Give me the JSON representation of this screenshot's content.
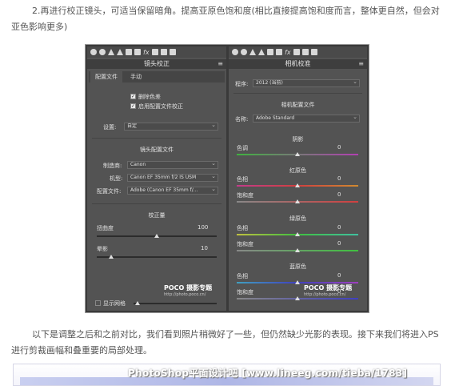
{
  "article": {
    "para1": "2.再进行校正镜头，可适当保留暗角。提高亚原色饱和度(相比直接提高饱和度而言，整体更自然，但会对亚色影响更多)",
    "para2": "以下是调整之后和之前对比，我们看到照片稍微好了一些，但仍然缺少光影的表现。接下来我们将进入PS进行剪裁画幅和叠重要的局部处理。",
    "overlay": "PhotoShop平面设计吧 [www.lineeg.com/tieba/1783]"
  },
  "left": {
    "title": "镜头校正",
    "menu": "≡",
    "tabs": [
      "配置文件",
      "手动"
    ],
    "checkbox1": "删除色差",
    "checkbox2": "启用配置文件校正",
    "setup_label": "设置:",
    "setup_value": "自定",
    "section_profile": "镜头配置文件",
    "make_label": "制造商:",
    "make_value": "Canon",
    "model_label": "机型:",
    "model_value": "Canon EF 35mm f/2 IS USM",
    "profile_label": "配置文件:",
    "profile_value": "Adobe (Canon EF 35mm f/...",
    "section_amount": "校正量",
    "distortion_label": "扭曲度",
    "distortion_value": "100",
    "vignette_label": "晕影",
    "vignette_value": "10",
    "grid_label": "显示网格",
    "watermark": "POCO 摄影专题",
    "watermark_url": "http://photo.poco.cn/"
  },
  "right": {
    "title": "相机校准",
    "menu": "≡",
    "process_label": "程序:",
    "process_value": "2012 (当前)",
    "section_profile": "相机配置文件",
    "name_label": "名称:",
    "name_value": "Adobe Standard",
    "shadow_section": "阴影",
    "tint_label": "色调",
    "tint_value": "0",
    "red_section": "红原色",
    "red_hue_label": "色相",
    "red_hue_value": "0",
    "red_sat_label": "饱和度",
    "red_sat_value": "0",
    "green_section": "绿原色",
    "green_hue_label": "色相",
    "green_hue_value": "0",
    "green_sat_label": "饱和度",
    "green_sat_value": "0",
    "blue_section": "蓝原色",
    "blue_hue_label": "色相",
    "blue_hue_value": "0",
    "blue_sat_label": "饱和度",
    "blue_sat_value": "0",
    "watermark": "POCO 摄影专题",
    "watermark_url": "http://photo.poco.cn/"
  },
  "sliders": {
    "distortion": 0.5,
    "vignette": 0.12,
    "tint": 0.5,
    "red_hue": 0.5,
    "red_sat": 0.5,
    "green_hue": 0.5,
    "green_sat": 0.5,
    "blue_hue": 0.5,
    "blue_sat": 0.5
  }
}
